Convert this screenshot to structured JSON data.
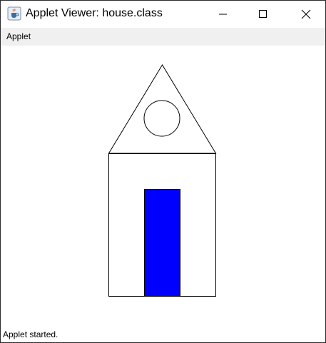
{
  "window": {
    "title": "Applet Viewer: house.class",
    "app_icon": "java-cup-icon"
  },
  "controls": {
    "minimize_icon": "minimize-icon",
    "maximize_icon": "maximize-icon",
    "close_icon": "close-icon"
  },
  "menu": {
    "items": [
      "Applet"
    ]
  },
  "status": {
    "text": "Applet started."
  },
  "drawing": {
    "stroke_color": "#000000",
    "door_color": "#0000ff",
    "shapes": [
      "roof-triangle",
      "roof-window-circle",
      "house-body-rectangle",
      "door-rectangle"
    ]
  }
}
